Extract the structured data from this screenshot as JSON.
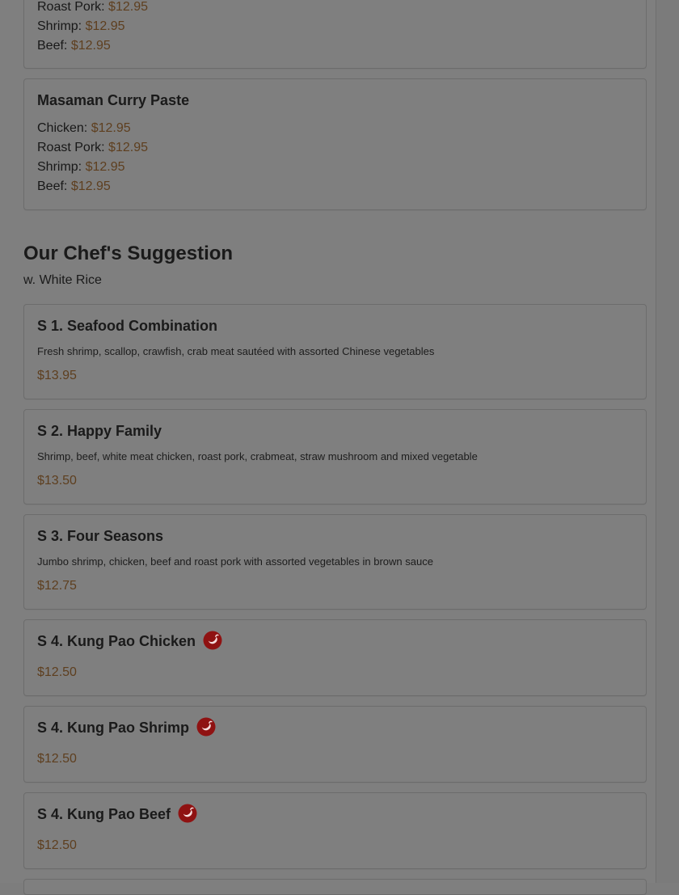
{
  "top_card": {
    "lines": [
      {
        "label": "Roast Pork:",
        "price": "$12.95"
      },
      {
        "label": "Shrimp:",
        "price": "$12.95"
      },
      {
        "label": "Beef:",
        "price": "$12.95"
      }
    ]
  },
  "masaman_card": {
    "title": "Masaman Curry Paste",
    "lines": [
      {
        "label": "Chicken:",
        "price": "$12.95"
      },
      {
        "label": "Roast Pork:",
        "price": "$12.95"
      },
      {
        "label": "Shrimp:",
        "price": "$12.95"
      },
      {
        "label": "Beef:",
        "price": "$12.95"
      }
    ]
  },
  "chef_section": {
    "title": "Our Chef's Suggestion",
    "subtitle": "w. White Rice"
  },
  "items": [
    {
      "title": "S 1. Seafood Combination",
      "description": "Fresh shrimp, scallop, crawfish, crab meat sautéed with assorted Chinese vegetables",
      "price": "$13.95",
      "spicy": false
    },
    {
      "title": "S 2. Happy Family",
      "description": "Shrimp, beef, white meat chicken, roast pork, crabmeat, straw mushroom and mixed vegetable",
      "price": "$13.50",
      "spicy": false
    },
    {
      "title": "S 3. Four Seasons",
      "description": "Jumbo shrimp, chicken, beef and roast pork with assorted vegetables in brown sauce",
      "price": "$12.75",
      "spicy": false
    },
    {
      "title": "S 4. Kung Pao Chicken",
      "description": "",
      "price": "$12.50",
      "spicy": true
    },
    {
      "title": "S 4. Kung Pao Shrimp",
      "description": "",
      "price": "$12.50",
      "spicy": true
    },
    {
      "title": "S 4. Kung Pao Beef",
      "description": "",
      "price": "$12.50",
      "spicy": true
    }
  ],
  "icons": {
    "spicy": "chili-pepper-icon"
  },
  "colors": {
    "price": "#5e3f1f",
    "spicy_icon": "#8f1212"
  }
}
